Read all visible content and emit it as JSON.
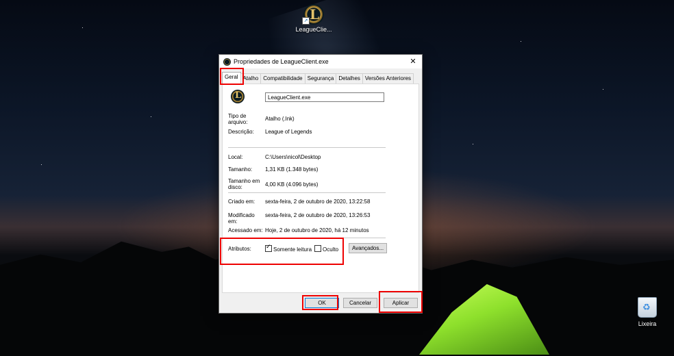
{
  "desktop": {
    "icon_label": "LeagueClie...",
    "recycle_label": "Lixeira"
  },
  "dialog": {
    "title": "Propriedades de LeagueClient.exe",
    "close_glyph": "✕",
    "tabs": [
      "Geral",
      "Atalho",
      "Compatibilidade",
      "Segurança",
      "Detalhes",
      "Versões Anteriores"
    ],
    "file_name": "LeagueClient.exe",
    "fields": {
      "tipo_label_1": "Tipo de",
      "tipo_label_2": "arquivo:",
      "tipo_value": "Atalho (.lnk)",
      "descricao_label": "Descrição:",
      "descricao_value": "League of Legends",
      "local_label": "Local:",
      "local_value": "C:\\Users\\nicol\\Desktop",
      "tamanho_label": "Tamanho:",
      "tamanho_value": "1,31 KB (1.348 bytes)",
      "tamanho_disco_label_1": "Tamanho em",
      "tamanho_disco_label_2": "disco:",
      "tamanho_disco_value": "4,00 KB (4.096 bytes)",
      "criado_label": "Criado em:",
      "criado_value": "sexta-feira, 2 de outubro de 2020, 13:22:58",
      "modificado_label_1": "Modificado",
      "modificado_label_2": "em:",
      "modificado_value": "sexta-feira, 2 de outubro de 2020, 13:26:53",
      "acessado_label": "Acessado em:",
      "acessado_value": "Hoje, 2 de outubro de 2020, há 12 minutos"
    },
    "attributes": {
      "label": "Atributos:",
      "readonly_label": "Somente leitura",
      "readonly_checked": true,
      "hidden_label": "Oculto",
      "hidden_checked": false,
      "advanced_button": "Avançados..."
    },
    "buttons": {
      "ok": "OK",
      "cancel": "Cancelar",
      "apply": "Aplicar"
    }
  },
  "colors": {
    "highlight": "#e00000",
    "accent": "#0078d7"
  }
}
